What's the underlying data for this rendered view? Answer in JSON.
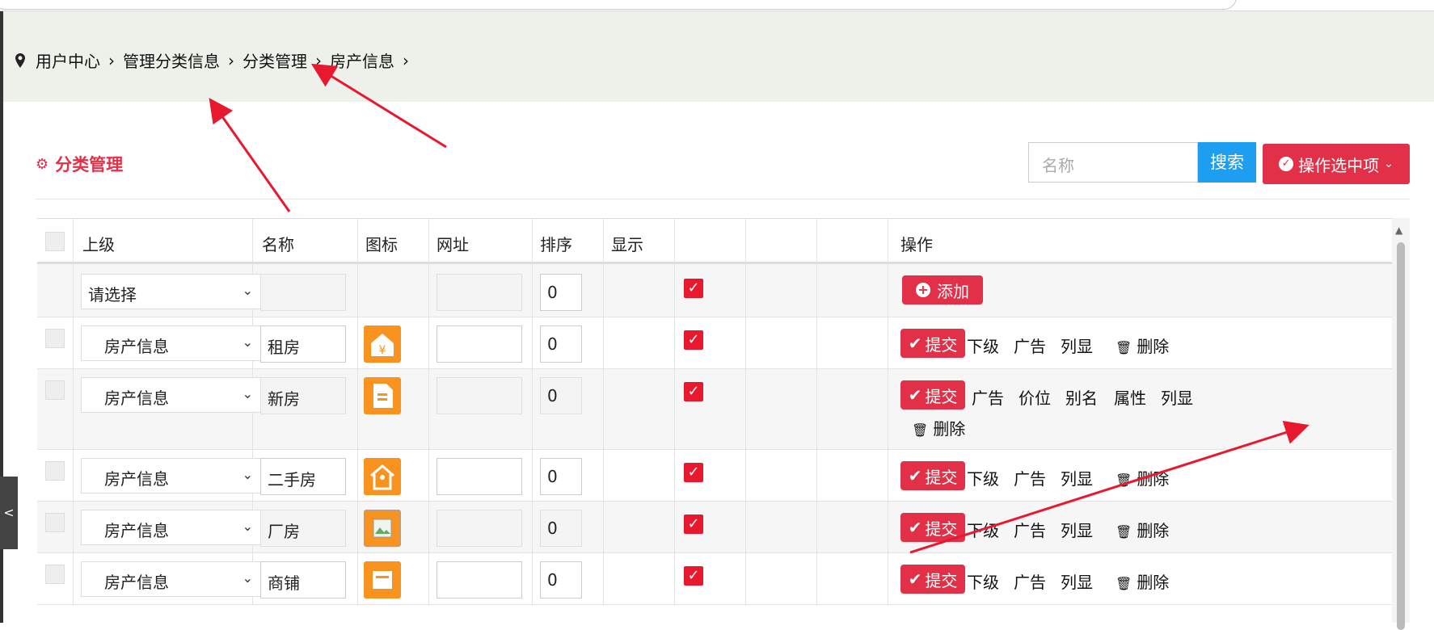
{
  "breadcrumb": [
    "用户中心",
    "管理分类信息",
    "分类管理",
    "房产信息"
  ],
  "page_title": "分类管理",
  "search": {
    "placeholder": "名称",
    "button": "搜索"
  },
  "batch_button": "操作选中项",
  "headers": {
    "parent": "上级",
    "name": "名称",
    "icon": "图标",
    "url": "网址",
    "order": "排序",
    "show": "显示",
    "ops": "操作"
  },
  "new_row": {
    "parent": "请选择",
    "order": "0",
    "add_label": "添加"
  },
  "rows": [
    {
      "parent": "房产信息",
      "name": "租房",
      "order": "0",
      "icon": "rent-house-icon",
      "actions": [
        "提交",
        "下级",
        "广告",
        "列显",
        "删除"
      ]
    },
    {
      "parent": "房产信息",
      "name": "新房",
      "order": "0",
      "icon": "new-house-doc-icon",
      "actions": [
        "提交",
        "广告",
        "价位",
        "别名",
        "属性",
        "列显",
        "删除"
      ]
    },
    {
      "parent": "房产信息",
      "name": "二手房",
      "order": "0",
      "icon": "second-hand-house-icon",
      "actions": [
        "提交",
        "下级",
        "广告",
        "列显",
        "删除"
      ]
    },
    {
      "parent": "房产信息",
      "name": "厂房",
      "order": "0",
      "icon": "broken-image-icon",
      "actions": [
        "提交",
        "下级",
        "广告",
        "列显",
        "删除"
      ]
    },
    {
      "parent": "房产信息",
      "name": "商铺",
      "order": "0",
      "icon": "shop-icon",
      "actions": [
        "提交",
        "下级",
        "广告",
        "列显",
        "删除"
      ]
    }
  ],
  "side_handle": "<",
  "colors": {
    "accent": "#e23048",
    "search_blue": "#1e9ef0",
    "icon_orange": "#f7931e",
    "breadcrumb_bg": "#edf1ea"
  }
}
